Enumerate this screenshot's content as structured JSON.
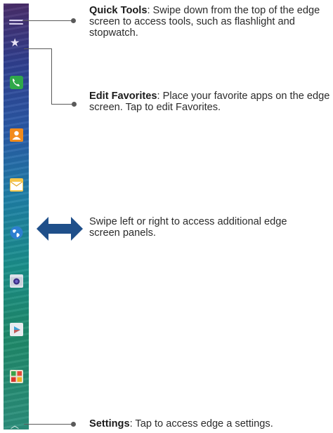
{
  "callouts": {
    "quick_tools": {
      "title": "Quick Tools",
      "text": ": Swipe down from the top of the edge screen to access tools, such as flashlight and stopwatch."
    },
    "edit_favorites": {
      "title": "Edit Favorites",
      "text": ": Place your favorite apps on the edge screen. Tap to edit Favorites."
    },
    "swipe": {
      "text": "Swipe left or right to access additional edge screen panels."
    },
    "settings": {
      "title": "Settings",
      "text": ": Tap to access edge a settings."
    }
  },
  "edge_icons": [
    "handle-icon",
    "star-icon",
    "phone-icon",
    "contacts-icon",
    "email-icon",
    "internet-icon",
    "camera-icon",
    "play-store-icon",
    "folder-icon",
    "chevron-up-icon"
  ],
  "colors": {
    "callout_line": "#5a5a5a",
    "arrow": "#1f4f8a"
  }
}
